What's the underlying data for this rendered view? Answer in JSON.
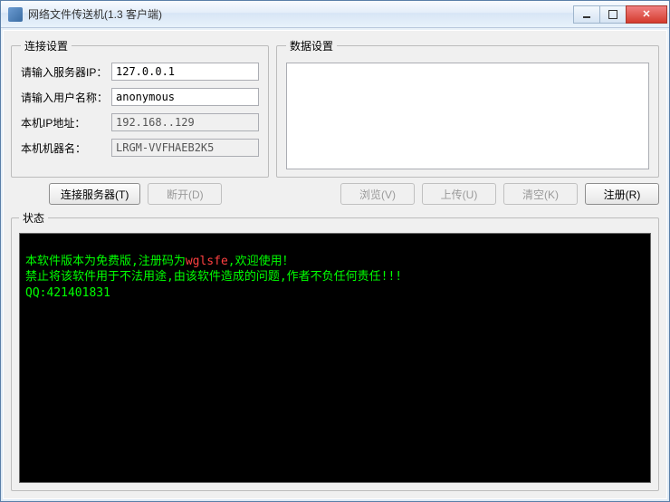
{
  "window": {
    "title": "网络文件传送机(1.3 客户端)"
  },
  "conn": {
    "legend": "连接设置",
    "server_ip_label": "请输入服务器IP：",
    "server_ip_value": "127.0.0.1",
    "username_label": "请输入用户名称：",
    "username_value": "anonymous",
    "local_ip_label": "本机IP地址：",
    "local_ip_value": "192.168..129",
    "machine_name_label": "本机机器名：",
    "machine_name_value": "LRGM-VVFHAEB2K5"
  },
  "data_settings": {
    "legend": "数据设置"
  },
  "buttons": {
    "connect": "连接服务器(T)",
    "disconnect": "断开(D)",
    "browse": "浏览(V)",
    "upload": "上传(U)",
    "clear": "清空(K)",
    "register": "注册(R)"
  },
  "status": {
    "legend": "状态",
    "line1_a": "本软件版本为免费版,注册码为",
    "line1_code": "wglsfe",
    "line1_b": ",欢迎使用！",
    "line2": "禁止将该软件用于不法用途,由该软件造成的问题,作者不负任何责任!!!",
    "line3": "QQ:421401831"
  }
}
